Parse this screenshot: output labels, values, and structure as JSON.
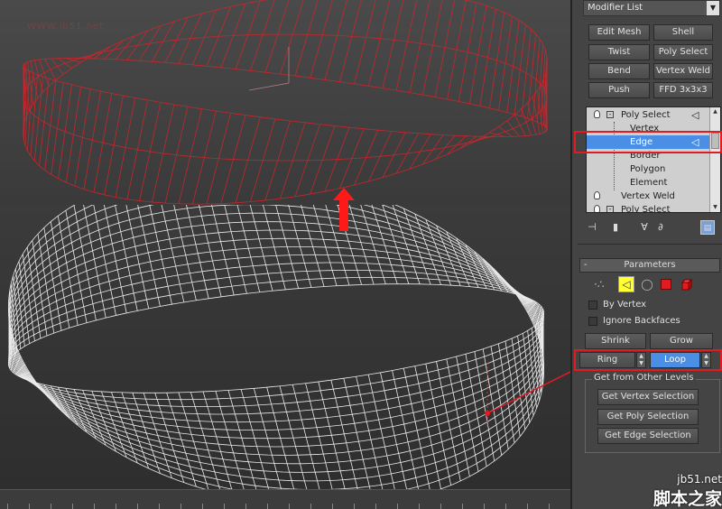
{
  "viewport": {
    "watermark": "WWW.jb51.net"
  },
  "panel": {
    "modifier_list": "Modifier List",
    "buttons": [
      "Edit Mesh",
      "Shell",
      "Twist",
      "Poly Select",
      "Bend",
      "Vertex Weld",
      "Push",
      "FFD 3x3x3"
    ],
    "stack": {
      "items": [
        "Poly Select",
        "Vertex",
        "Edge",
        "Border",
        "Polygon",
        "Element",
        "Vertex Weld",
        "Poly Select"
      ],
      "selected": "Edge"
    },
    "parameters": {
      "title": "Parameters",
      "by_vertex": "By Vertex",
      "ignore_backfaces": "Ignore Backfaces",
      "shrink": "Shrink",
      "grow": "Grow",
      "ring": "Ring",
      "loop": "Loop",
      "group_title": "Get from Other Levels",
      "get_vertex": "Get Vertex Selection",
      "get_poly": "Get Poly Selection",
      "get_edge": "Get Edge Selection"
    }
  },
  "watermark": {
    "site": "jb51.net",
    "cn": "脚本之家"
  },
  "colors": {
    "highlight": "#e11b22",
    "selected": "#4a8ee6",
    "wire_top": "#d4242a",
    "wire_bottom": "#ffffff"
  }
}
